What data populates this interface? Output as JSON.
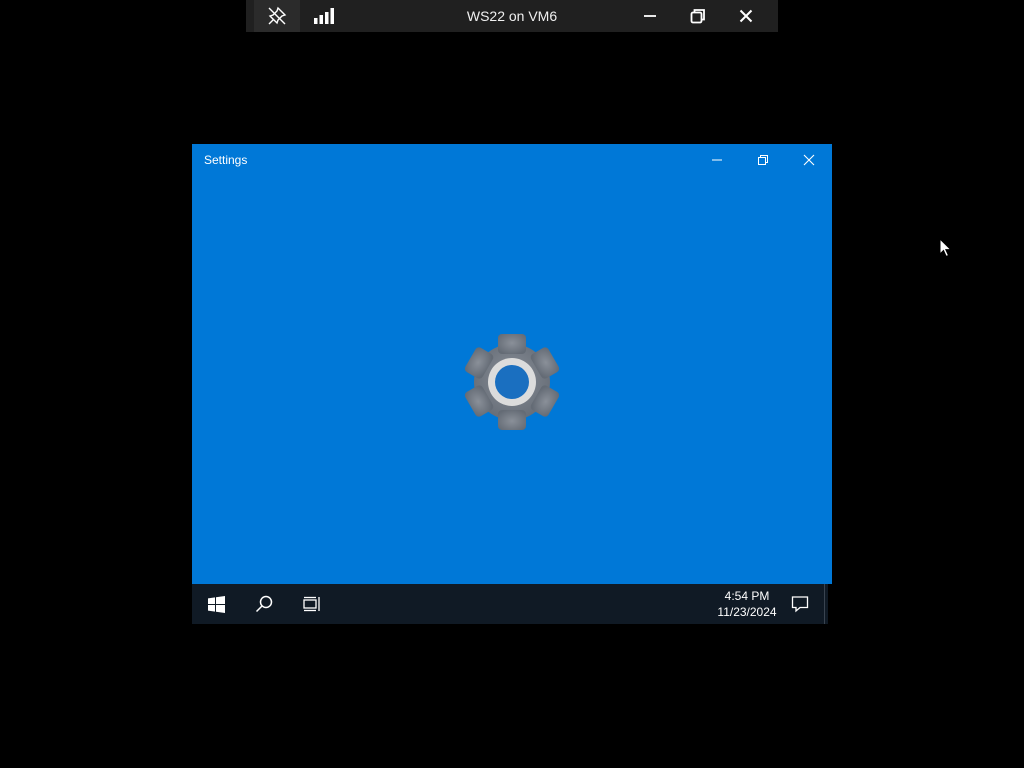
{
  "rdp_bar": {
    "title": "WS22 on VM6",
    "icons": [
      "pin-icon",
      "connection-signal-icon",
      "minimize-icon",
      "restore-icon",
      "close-icon"
    ]
  },
  "settings_window": {
    "title": "Settings",
    "background_color": "#0078d7",
    "splash_icon": "gear-icon",
    "controls": [
      "minimize-icon",
      "restore-icon",
      "close-icon"
    ]
  },
  "taskbar": {
    "background_color": "#101a25",
    "buttons": [
      "windows-start-icon",
      "search-icon",
      "task-view-icon",
      "action-center-icon"
    ],
    "clock": {
      "time": "4:54 PM",
      "date": "11/23/2024"
    }
  }
}
